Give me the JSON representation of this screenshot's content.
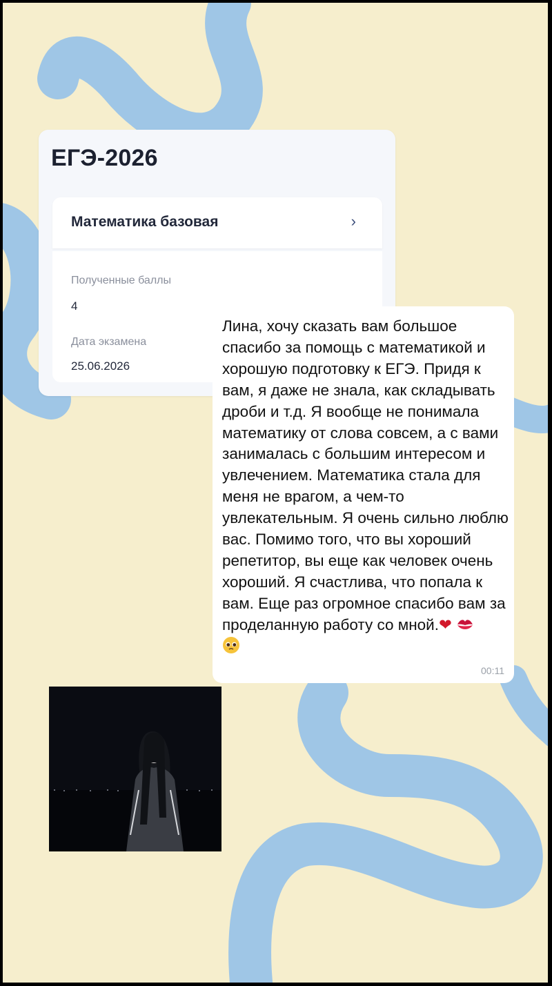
{
  "colors": {
    "background": "#f6eecd",
    "wave": "#9fc6e6",
    "card": "#f5f7fb",
    "bubble": "#ffffff"
  },
  "result_card": {
    "title": "ЕГЭ-2026",
    "subject": "Математика базовая",
    "chevron_icon": "chevron-right-icon",
    "score_label": "Полученные баллы",
    "score_value": "4",
    "date_label": "Дата экзамена",
    "date_value": "25.06.2026"
  },
  "message": {
    "text": "Лина, хочу сказать вам большое спасибо за помощь с математикой и хорошую подготовку к ЕГЭ. Придя к вам, я даже не знала, как складывать дроби и т.д. Я вообще не понимала математику от слова совсем, а с вами занималась с большим интересом и увлечением. Математика стала для меня не врагом, а чем-то увлекательным. Я очень сильно люблю вас. Помимо того, что вы хороший репетитор, вы еще как человек очень хороший. Я счастлива, что попала к вам. Еще раз огромное спасибо вам за проделанную работу со мной.",
    "emoji_icons": [
      "red-heart-icon",
      "kiss-mark-icon",
      "pleading-face-icon"
    ],
    "time": "00:11"
  },
  "photo": {
    "icon": "student-photo"
  }
}
